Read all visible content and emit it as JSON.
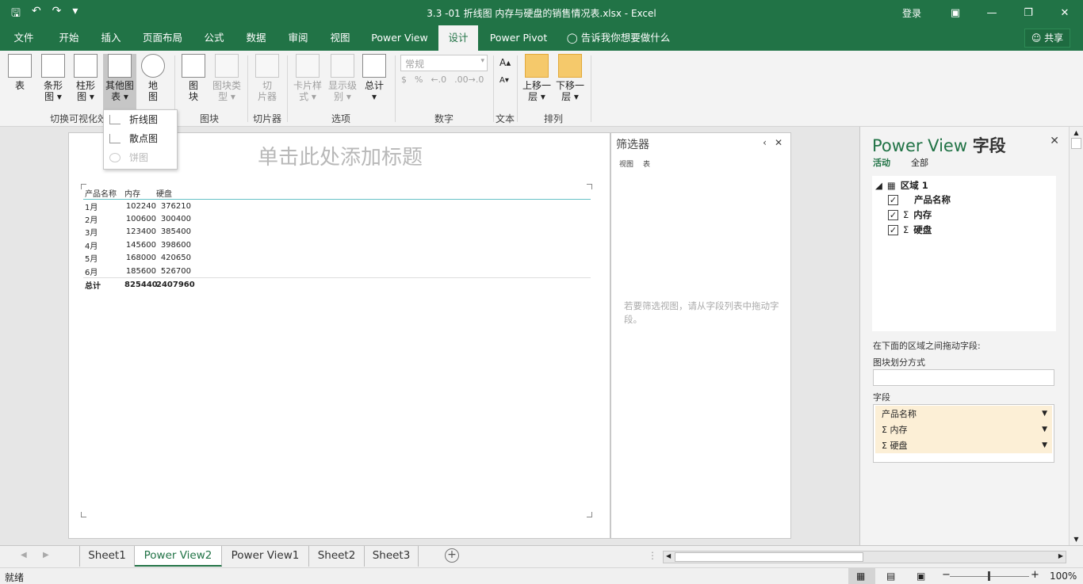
{
  "titlebar": {
    "title": "3.3 -01 折线图 内存与硬盘的销售情况表.xlsx  -  Excel",
    "login": "登录",
    "qat_icons": [
      "save-icon",
      "undo-icon",
      "redo-icon",
      "customize-icon"
    ]
  },
  "menu": {
    "tabs": [
      "文件",
      "开始",
      "插入",
      "页面布局",
      "公式",
      "数据",
      "审阅",
      "视图",
      "Power View",
      "设计",
      "Power Pivot"
    ],
    "active": "设计",
    "tell_me": "告诉我你想要做什么",
    "share": "共享"
  },
  "ribbon": {
    "buttons": {
      "table": [
        "表",
        ""
      ],
      "bar": [
        "条形",
        "图 ▾"
      ],
      "column": [
        "柱形",
        "图 ▾"
      ],
      "other": [
        "其他图",
        "表 ▾"
      ],
      "map": [
        "地",
        "图"
      ],
      "tiles": [
        "图",
        "块"
      ],
      "tile_type": [
        "图块类",
        "型 ▾"
      ],
      "slicer": [
        "切",
        "片器"
      ],
      "card_style": [
        "卡片样",
        "式 ▾"
      ],
      "show_levels": [
        "显示级",
        "别 ▾"
      ],
      "totals": [
        "总计",
        "▾"
      ],
      "bring_forward": [
        "上移一",
        "层 ▾"
      ],
      "send_backward": [
        "下移一",
        "层 ▾"
      ]
    },
    "number_format": "常规",
    "number_symbols": [
      "$",
      "%",
      "←.0",
      ".00→.0"
    ],
    "font_size_icons": [
      "A▴",
      "A▾"
    ],
    "groups": [
      "切换可视化效果",
      "图块",
      "切片器",
      "选项",
      "数字",
      "文本",
      "排列"
    ]
  },
  "dropdown": {
    "items": [
      "折线图",
      "散点图",
      "饼图"
    ],
    "disabled": [
      "饼图"
    ]
  },
  "canvas": {
    "title_placeholder": "单击此处添加标题",
    "table": {
      "headers": [
        "产品名称",
        "内存",
        "硬盘"
      ],
      "rows": [
        [
          "1月",
          "102240",
          "376210"
        ],
        [
          "2月",
          "100600",
          "300400"
        ],
        [
          "3月",
          "123400",
          "385400"
        ],
        [
          "4月",
          "145600",
          "398600"
        ],
        [
          "5月",
          "168000",
          "420650"
        ],
        [
          "6月",
          "185600",
          "526700"
        ]
      ],
      "total": [
        "总计",
        "825440",
        "2407960"
      ]
    }
  },
  "filters": {
    "title": "筛选器",
    "tabs": [
      "视图",
      "表"
    ],
    "hint": "若要筛选视图，请从字段列表中拖动字段。"
  },
  "fields_pane": {
    "title_prefix": "Power View ",
    "title_suffix": "字段",
    "tabs": [
      "活动",
      "全部"
    ],
    "tree": {
      "root": "区域 1",
      "fields": [
        {
          "name": "产品名称",
          "checked": true,
          "sigma": false
        },
        {
          "name": "内存",
          "checked": true,
          "sigma": true
        },
        {
          "name": "硬盘",
          "checked": true,
          "sigma": true
        }
      ]
    },
    "drag_hint": "在下面的区域之间拖动字段:",
    "tile_by": "图块划分方式",
    "fields_label": "字段",
    "field_list": [
      "产品名称",
      "Σ 内存",
      "Σ 硬盘"
    ]
  },
  "sheets": {
    "tabs": [
      "Sheet1",
      "Power View2",
      "Power View1",
      "Sheet2",
      "Sheet3"
    ],
    "active": "Power View2"
  },
  "status": {
    "left": "就绪",
    "zoom": "100%"
  },
  "colors": {
    "brand": "#217346",
    "field_bg": "#fcefd6",
    "table_rule": "#68c2c7"
  }
}
